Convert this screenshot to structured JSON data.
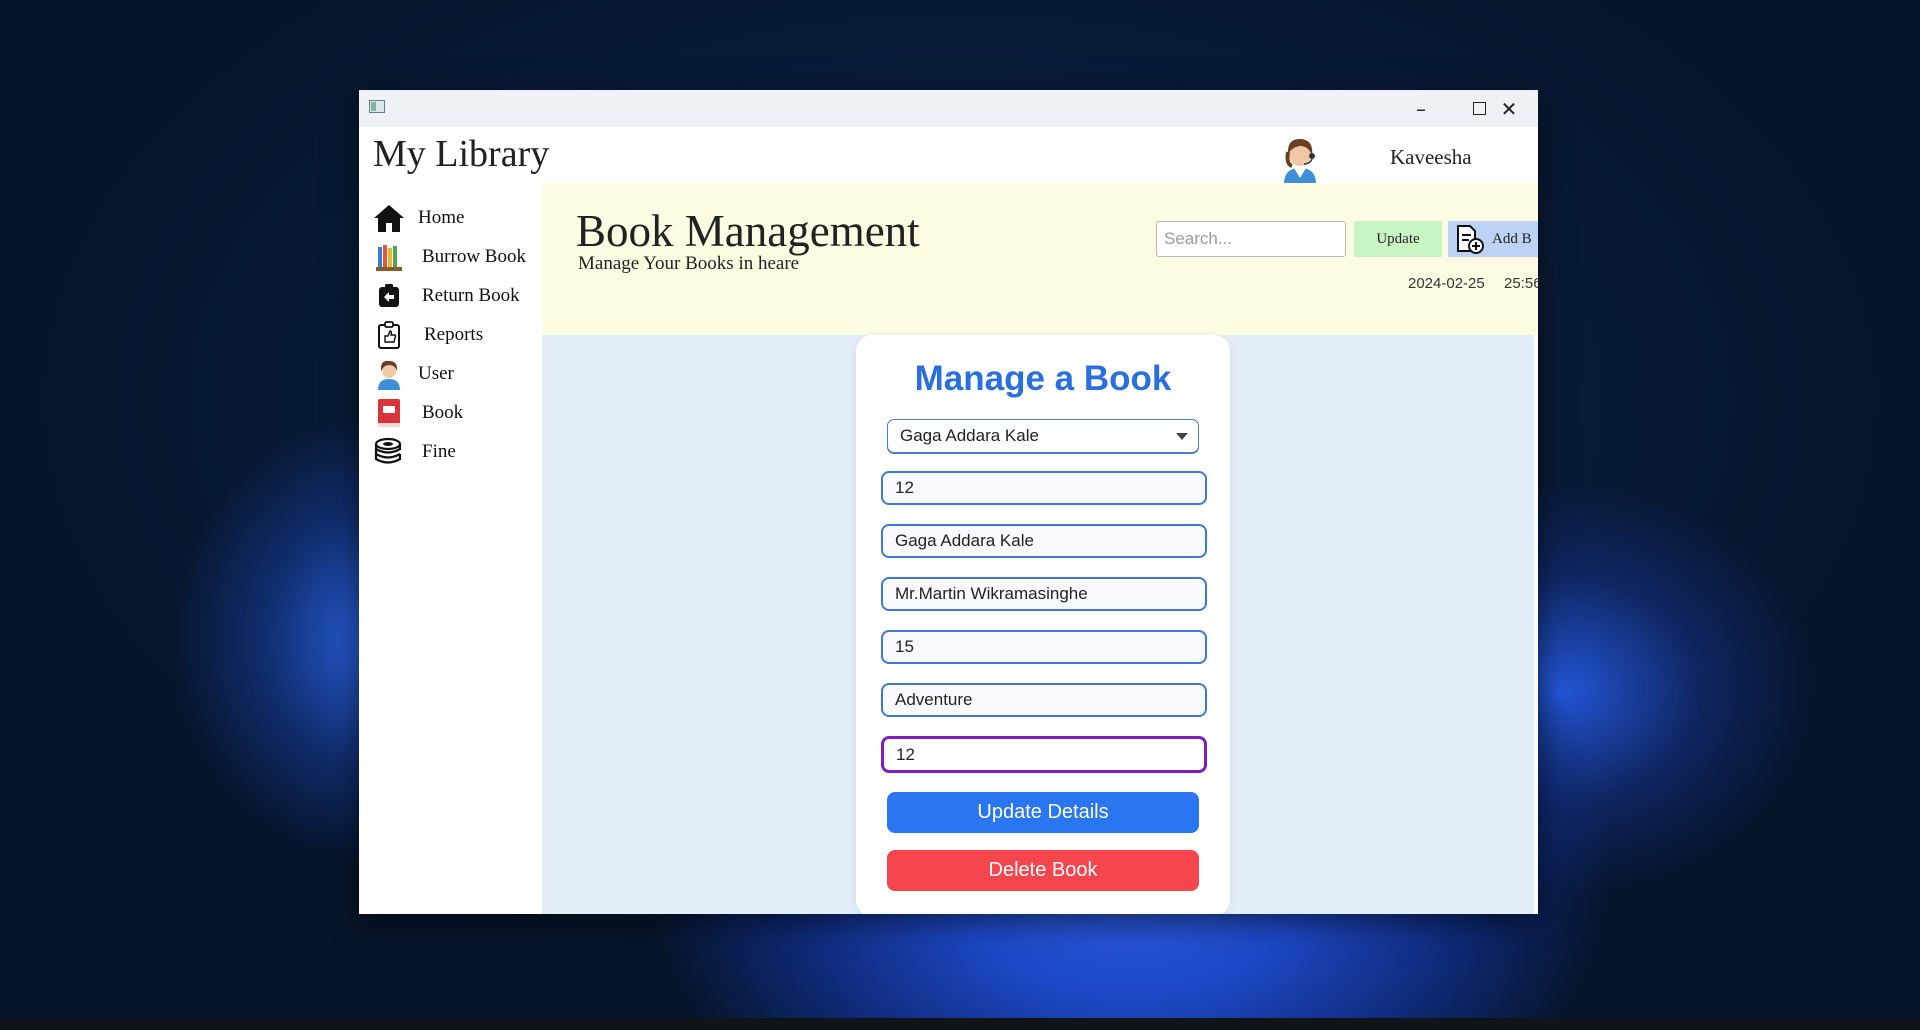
{
  "app": {
    "name": "My Library"
  },
  "user": {
    "name": "Kaveesha"
  },
  "sidebar": {
    "items": [
      {
        "label": "Home",
        "icon": "home-icon"
      },
      {
        "label": "Burrow Book",
        "icon": "books-icon"
      },
      {
        "label": "Return Book",
        "icon": "return-icon"
      },
      {
        "label": "Reports",
        "icon": "clipboard-icon"
      },
      {
        "label": "User",
        "icon": "user-icon"
      },
      {
        "label": "Book",
        "icon": "book-icon"
      },
      {
        "label": "Fine",
        "icon": "coins-icon"
      }
    ]
  },
  "header": {
    "title": "Book Management",
    "subtitle": "Manage Your Books in heare",
    "search_placeholder": "Search...",
    "update_label": "Update",
    "add_label": "Add B",
    "date": "2024-02-25",
    "time": "25:56"
  },
  "form": {
    "title": "Manage a Book",
    "selected_book": "Gaga Addara Kale",
    "fields": [
      "12",
      "Gaga Addara Kale",
      "Mr.Martin Wikramasinghe",
      "15",
      "Adventure",
      "12"
    ],
    "update_button": "Update Details",
    "delete_button": "Delete Book"
  },
  "colors": {
    "accent_blue": "#2a76f0",
    "title_blue": "#2a6fde",
    "danger_red": "#f5464d",
    "update_green": "#c9f5c5",
    "header_bg": "#fdfce3",
    "content_bg": "#e4eefb"
  }
}
